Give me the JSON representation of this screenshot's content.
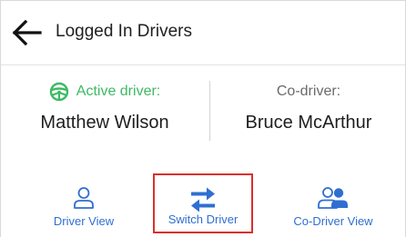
{
  "header": {
    "title": "Logged In Drivers",
    "back_icon": "arrow-left-icon"
  },
  "active_driver": {
    "role_label": "Active driver:",
    "name": "Matthew Wilson",
    "icon": "steering-wheel-icon",
    "color": "#3dba63"
  },
  "co_driver": {
    "role_label": "Co-driver:",
    "name": "Bruce McArthur"
  },
  "tabs": [
    {
      "label": "Driver View",
      "icon": "person-icon"
    },
    {
      "label": "Switch Driver",
      "icon": "swap-arrows-icon",
      "highlighted": true
    },
    {
      "label": "Co-Driver View",
      "icon": "two-people-icon"
    }
  ],
  "colors": {
    "accent": "#2f6fd0",
    "highlight_border": "#d9302c"
  }
}
